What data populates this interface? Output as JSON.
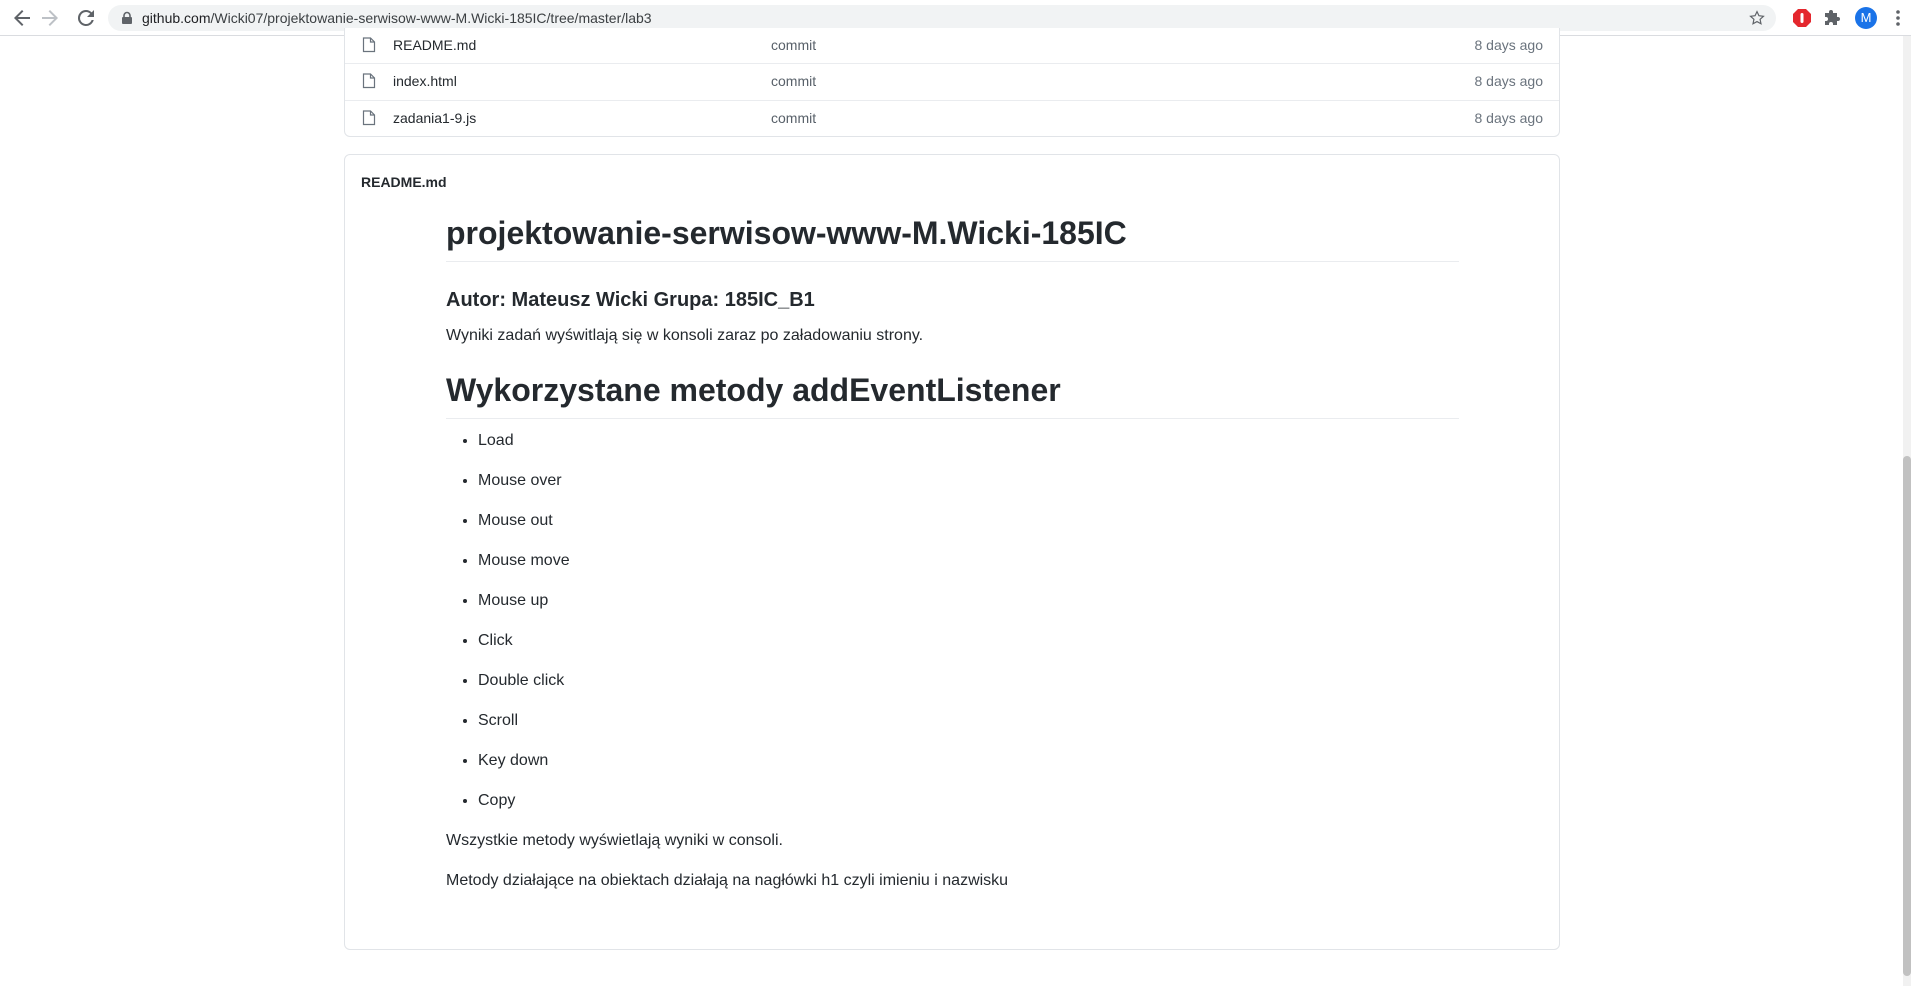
{
  "browser": {
    "url_host": "github.com",
    "url_path": "/Wicki07/projektowanie-serwisow-www-M.Wicki-185IC/tree/master/lab3",
    "avatar_letter": "M",
    "icons": [
      "back-arrow-icon",
      "forward-arrow-icon",
      "reload-icon",
      "lock-icon",
      "bookmark-star-icon",
      "adblock-icon",
      "extensions-puzzle-icon",
      "menu-kebab-icon"
    ]
  },
  "files": [
    {
      "name": "README.md",
      "commit": "commit",
      "age": "8 days ago"
    },
    {
      "name": "index.html",
      "commit": "commit",
      "age": "8 days ago"
    },
    {
      "name": "zadania1-9.js",
      "commit": "commit",
      "age": "8 days ago"
    }
  ],
  "readme": {
    "header": "README.md",
    "title": "projektowanie-serwisow-www-M.Wicki-185IC",
    "author": "Autor: Mateusz Wicki Grupa: 185IC_B1",
    "intro": "Wyniki zadań wyświtlają się w konsoli zaraz po załadowaniu strony.",
    "section_title": "Wykorzystane metody addEventListener",
    "methods": [
      "Load",
      "Mouse over",
      "Mouse out",
      "Mouse move",
      "Mouse up",
      "Click",
      "Double click",
      "Scroll",
      "Key down",
      "Copy"
    ],
    "note1": "Wszystkie metody wyświetlają wyniki w consoli.",
    "note2": "Metody działające na obiektach działają na nagłówki h1 czyli imieniu i nazwisku"
  },
  "colors": {
    "text": "#24292e",
    "border": "#e1e4e8",
    "avatar_bg": "#1a73e8",
    "adblock_red": "#e4272e"
  }
}
